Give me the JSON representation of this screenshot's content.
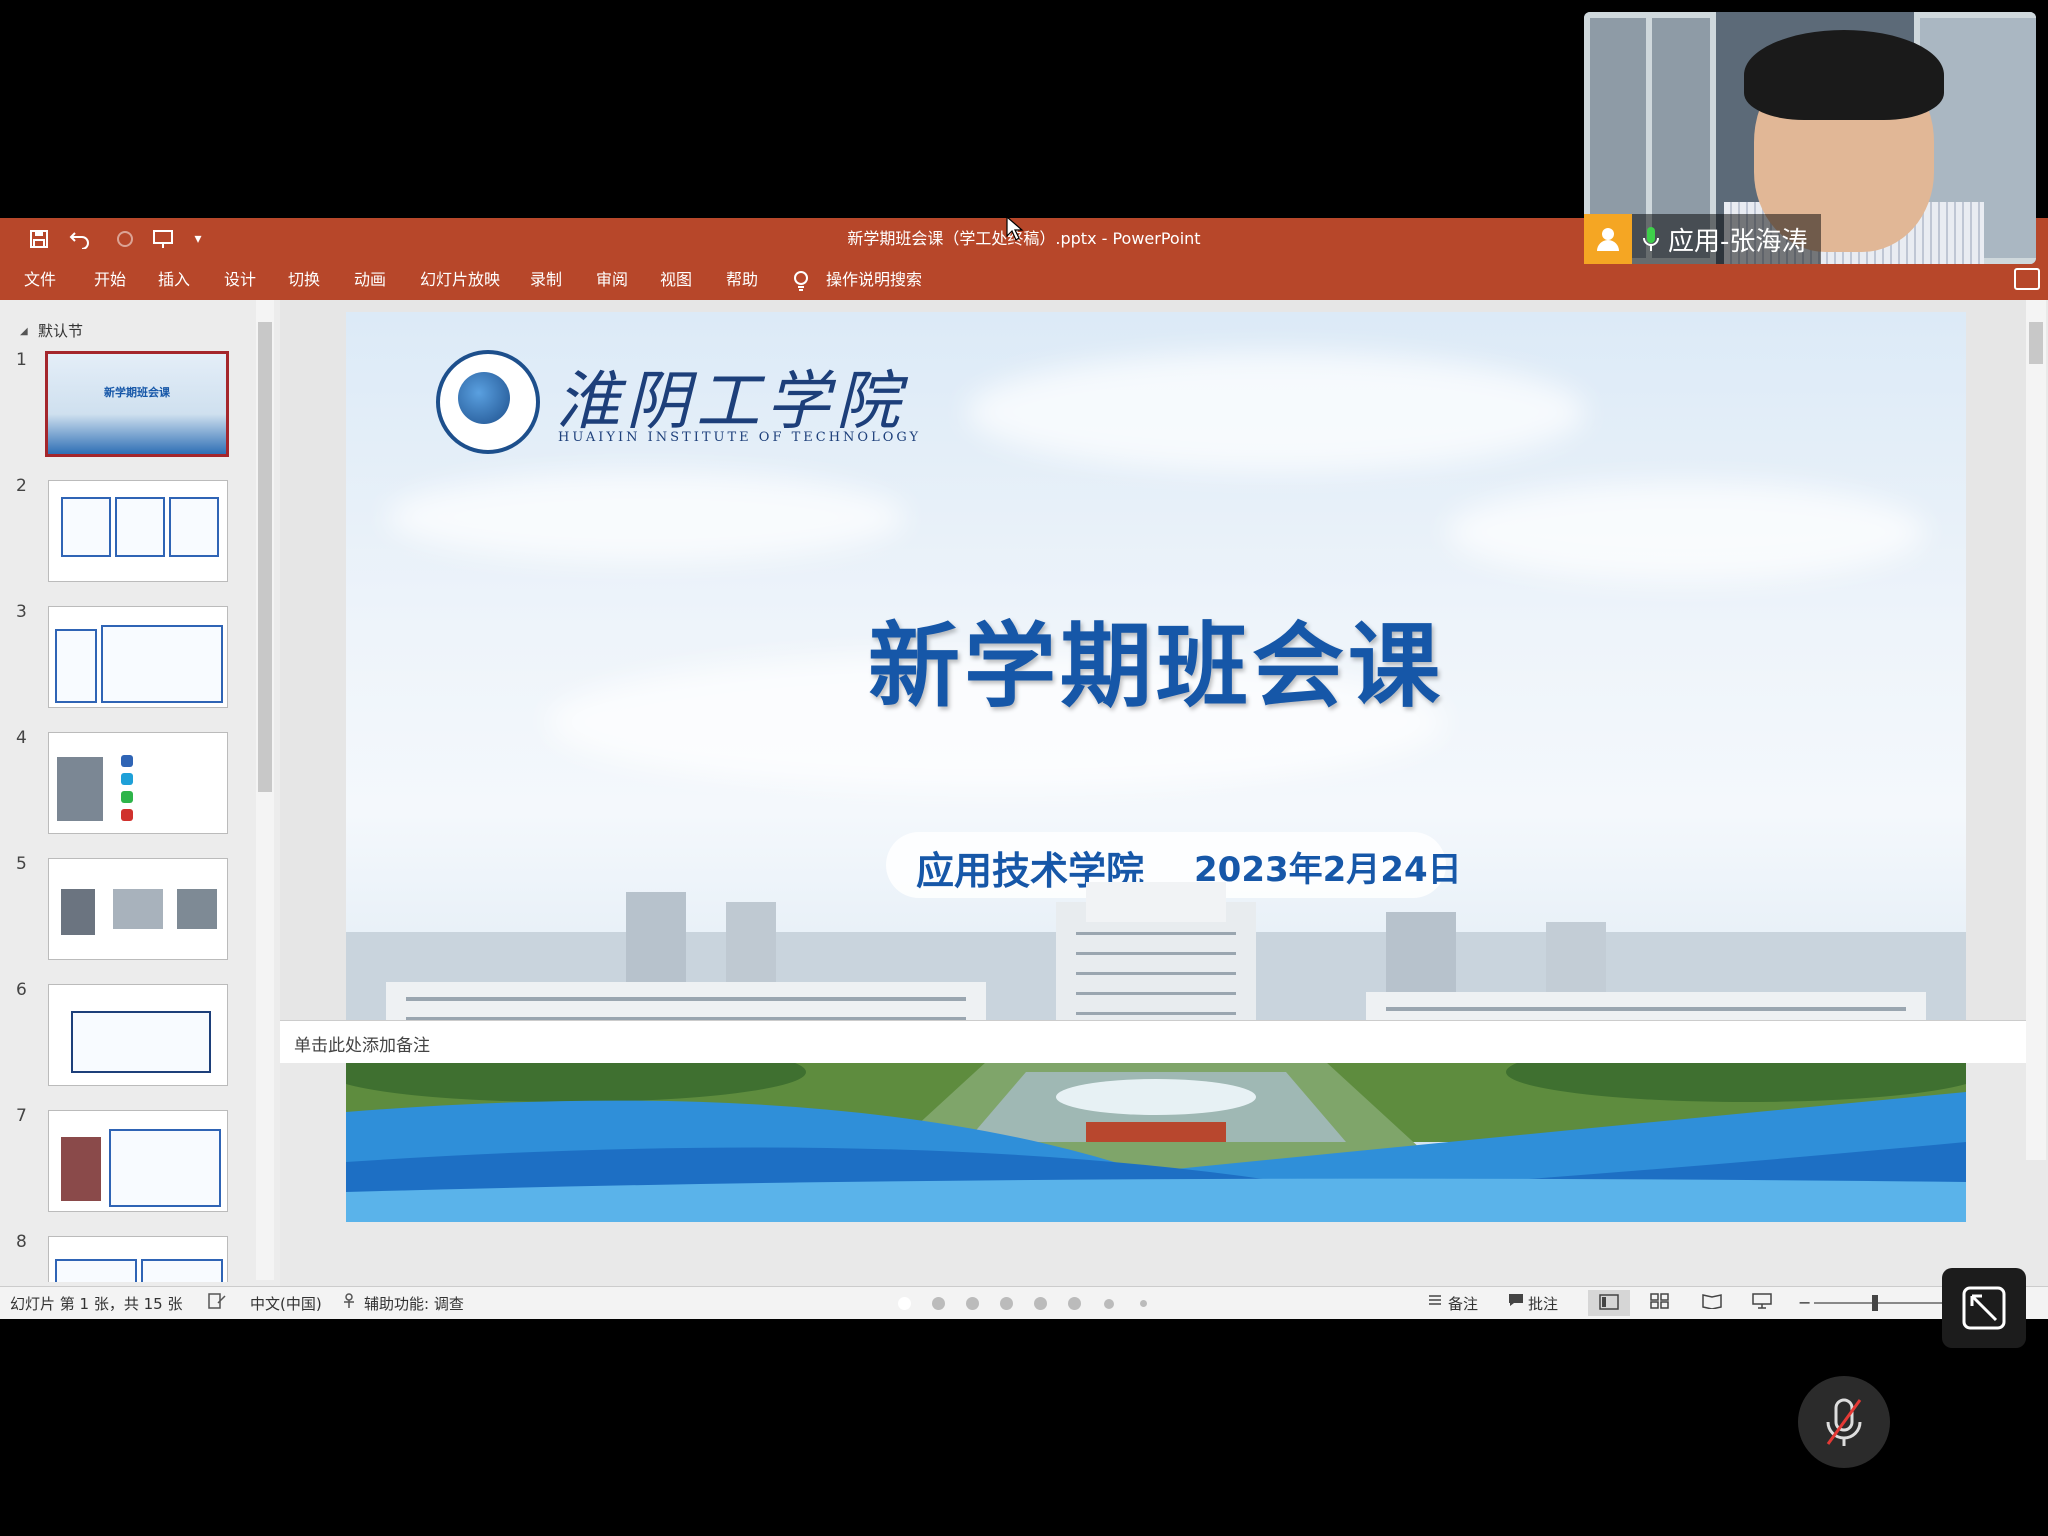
{
  "window": {
    "title": "新学期班会课（学工处终稿）.pptx  -  PowerPoint",
    "menu": [
      "文件",
      "开始",
      "插入",
      "设计",
      "切换",
      "动画",
      "幻灯片放映",
      "录制",
      "审阅",
      "视图",
      "帮助"
    ],
    "search_label": "操作说明搜索"
  },
  "thumbnails": {
    "section": "默认节",
    "numbers": [
      "1",
      "2",
      "3",
      "4",
      "5",
      "6",
      "7",
      "8"
    ],
    "first_title": "新学期班会课"
  },
  "slide": {
    "logo_cn": "淮阴工学院",
    "logo_en": "HUAIYIN INSTITUTE OF TECHNOLOGY",
    "title": "新学期班会课",
    "org": "应用技术学院",
    "date": "2023年2月24日"
  },
  "notes_placeholder": "单击此处添加备注",
  "status": {
    "slide_info": "幻灯片 第 1 张，共 15 张",
    "language": "中文(中国)",
    "accessibility": "辅助功能: 调查",
    "notes_label": "备注",
    "comments_label": "批注"
  },
  "meeting": {
    "participant_name": "应用-张海涛"
  },
  "colors": {
    "ribbon": "#b7472a",
    "slide_title": "#1657a8",
    "active_thumb_border": "#a4262c"
  }
}
